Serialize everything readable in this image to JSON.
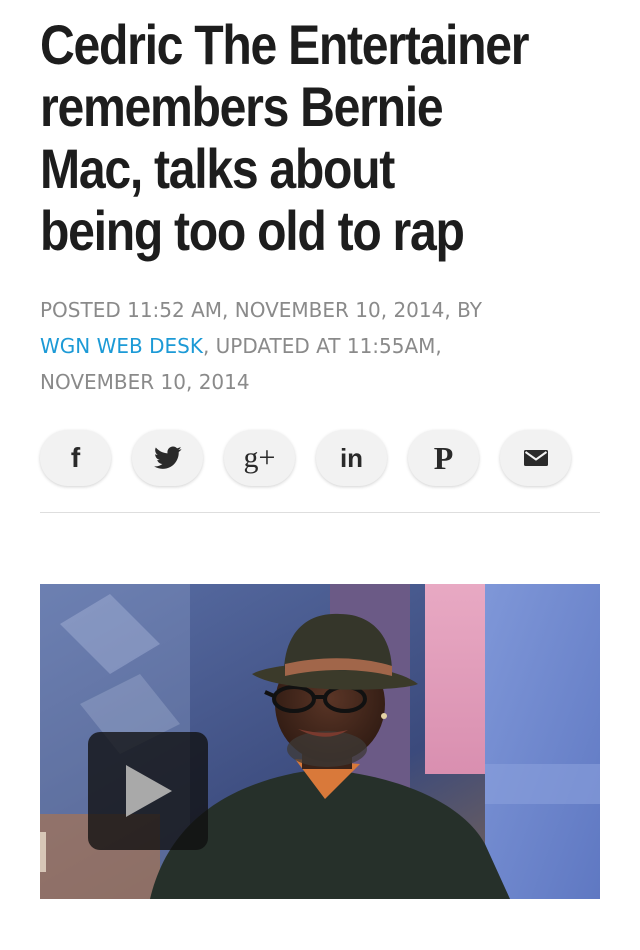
{
  "article": {
    "headline_lines": [
      "Cedric The Entertainer",
      "remembers Bernie",
      "Mac, talks about",
      "being too old to rap"
    ],
    "meta": {
      "posted_label": "POSTED 11:52 AM, NOVEMBER 10, 2014, BY",
      "author": "WGN WEB DESK",
      "updated_label": ", UPDATED AT 11:55AM,",
      "updated_date": "NOVEMBER 10, 2014"
    }
  },
  "share_buttons": [
    {
      "name": "facebook",
      "icon": "facebook-icon",
      "glyph": "f"
    },
    {
      "name": "twitter",
      "icon": "twitter-icon",
      "glyph": ""
    },
    {
      "name": "google-plus",
      "icon": "google-plus-icon",
      "glyph": "g+"
    },
    {
      "name": "linkedin",
      "icon": "linkedin-icon",
      "glyph": "in"
    },
    {
      "name": "pinterest",
      "icon": "pinterest-icon",
      "glyph": "P"
    },
    {
      "name": "email",
      "icon": "email-icon",
      "glyph": ""
    }
  ],
  "video": {
    "play_icon": "play-icon"
  },
  "colors": {
    "author_link": "#1c9ad6",
    "headline": "#1d1d1d",
    "meta_text": "#8a8a8a"
  }
}
